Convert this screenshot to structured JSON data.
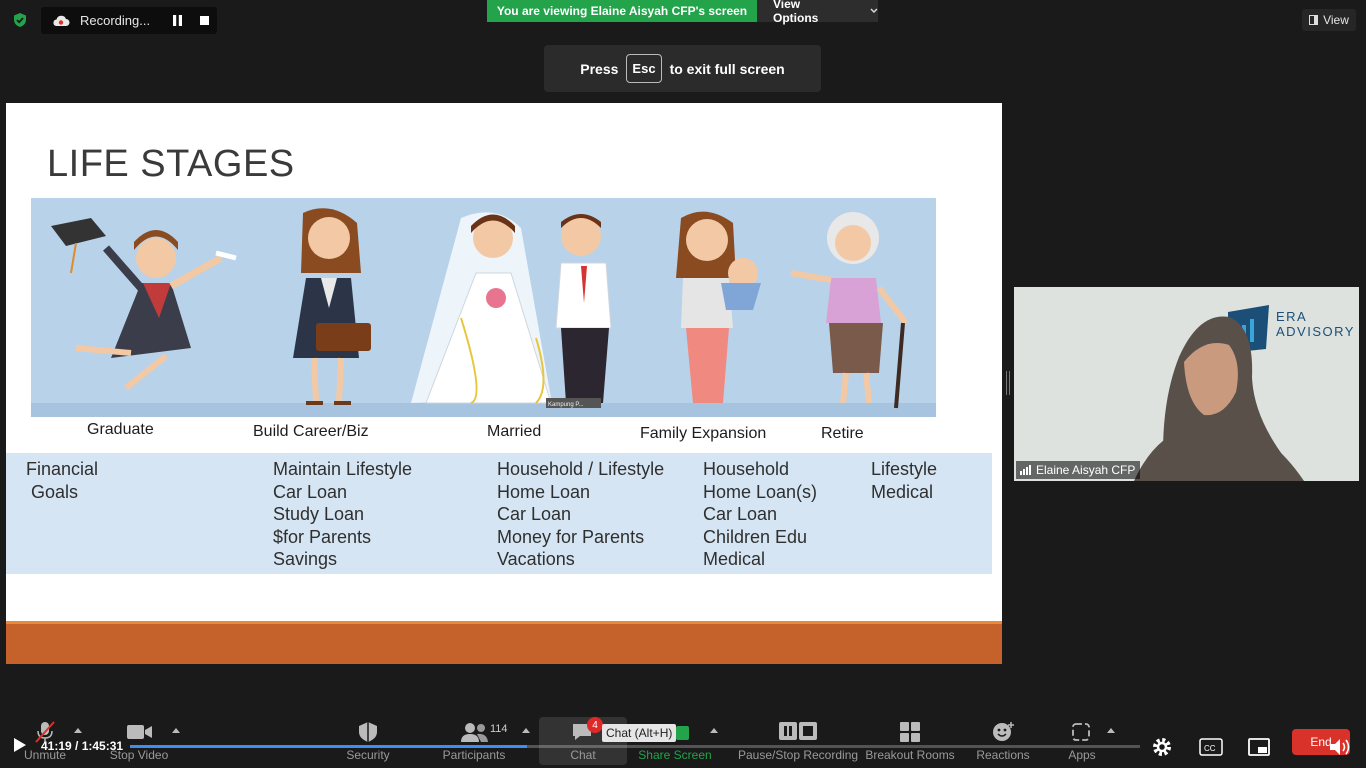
{
  "recording": {
    "label": "Recording..."
  },
  "banner": {
    "viewing": "You are viewing Elaine Aisyah CFP's screen",
    "view_options": "View Options",
    "view": "View"
  },
  "fullscreen": {
    "press": "Press",
    "key": "Esc",
    "rest": "to exit full screen"
  },
  "slide": {
    "title": "LIFE STAGES",
    "watermark": "Kampung P...",
    "stages": [
      "Graduate",
      "Build Career/Biz",
      "Married",
      "Family Expansion",
      "Retire"
    ],
    "goals": [
      [
        "Financial",
        " Goals"
      ],
      [
        "Maintain Lifestyle",
        "Car Loan",
        "Study Loan",
        "$for Parents",
        "Savings"
      ],
      [
        "Household / Lifestyle",
        "Home Loan",
        "Car Loan",
        "Money for Parents",
        "Vacations"
      ],
      [
        "Household",
        "Home Loan(s)",
        "Car Loan",
        "Children Edu",
        "Medical"
      ],
      [
        "Lifestyle",
        "Medical"
      ]
    ]
  },
  "participant": {
    "name": "Elaine Aisyah CFP",
    "logo_line1": "ERA",
    "logo_line2": "ADVISORY"
  },
  "toolbar": {
    "unmute": "Unmute",
    "stop_video": "Stop Video",
    "security": "Security",
    "participants": "Participants",
    "participants_count": "114",
    "chat": "Chat",
    "chat_badge": "4",
    "chat_tooltip": "Chat (Alt+H)",
    "share_screen": "Share Screen",
    "pause_stop_recording": "Pause/Stop Recording",
    "breakout_rooms": "Breakout Rooms",
    "reactions": "Reactions",
    "apps": "Apps",
    "end": "End"
  },
  "player": {
    "timecode": "41:19 / 1:45:31",
    "progress": 0.393
  },
  "colors": {
    "green": "#23a34a",
    "orange": "#c5612b",
    "end": "#d9322a",
    "progress": "#3d8ef0"
  }
}
